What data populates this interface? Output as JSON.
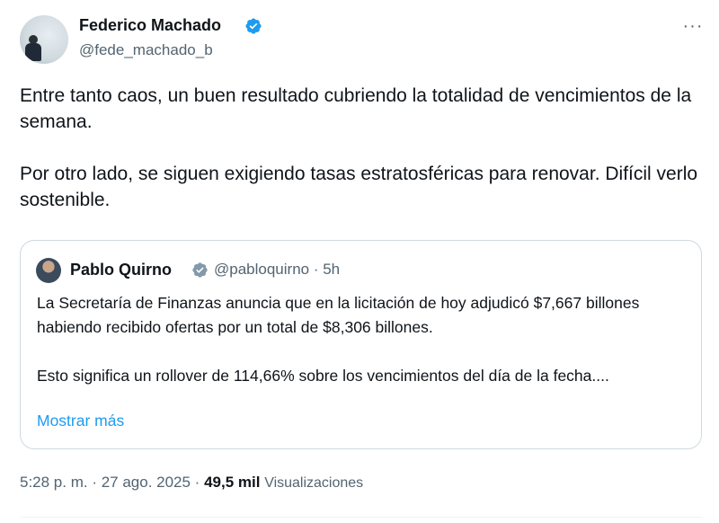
{
  "author": {
    "name": "Federico Machado",
    "handle": "@fede_machado_b",
    "verified": true
  },
  "tweet": {
    "paragraphs": [
      "Entre tanto caos, un buen resultado cubriendo la totalidad de vencimientos de la semana.",
      "Por otro lado, se siguen exigiendo tasas estratosféricas para renovar. Difícil verlo sostenible."
    ]
  },
  "quote": {
    "name": "Pablo Quirno",
    "handle_time": "@pabloquirno · 5h",
    "paragraphs": [
      "La Secretaría de Finanzas anuncia que en la licitación de hoy adjudicó $7,667 billones habiendo recibido ofertas por un total de $8,306 billones.",
      "Esto significa un rollover de 114,66% sobre los vencimientos del día de la fecha...."
    ],
    "show_more": "Mostrar más"
  },
  "meta": {
    "time_date": "5:28 p. m. · 27 ago. 2025 · ",
    "views_count": "49,5 mil",
    "views_label": "Visualizaciones"
  },
  "icons": {
    "more": "more-horizontal-icon",
    "verified": "verified-badge-icon"
  },
  "colors": {
    "verified_blue": "#1d9bf0",
    "verified_gray": "#829aab",
    "link": "#1d9bf0",
    "secondary_text": "#536471"
  }
}
